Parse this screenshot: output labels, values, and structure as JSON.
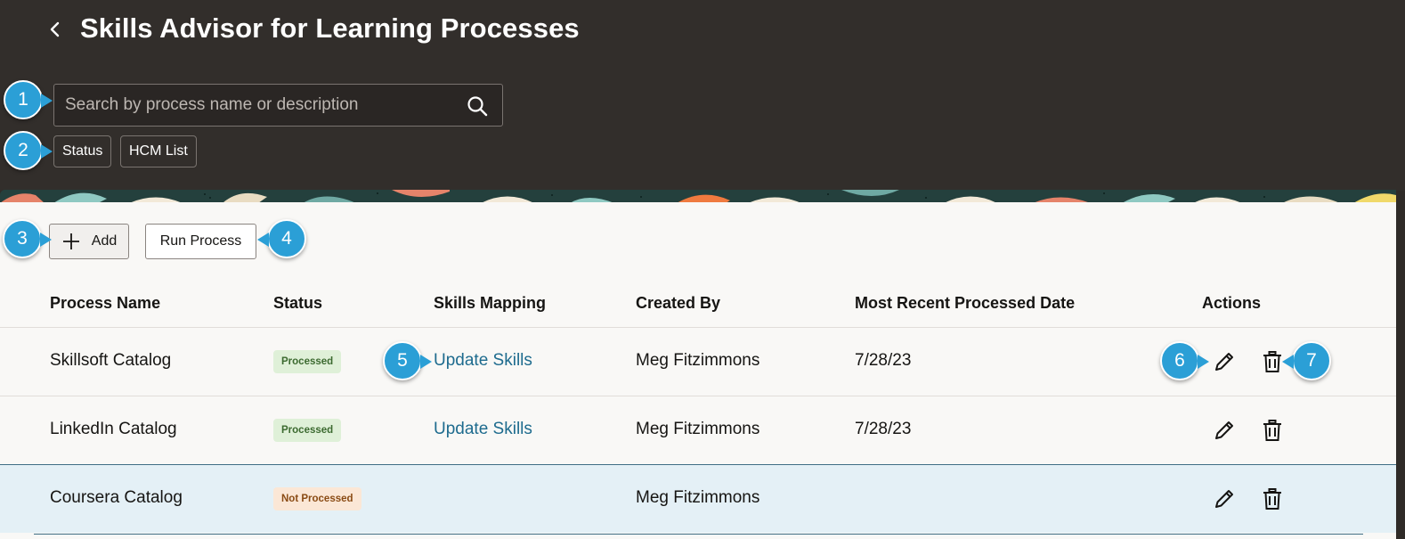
{
  "header": {
    "title": "Skills Advisor for Learning Processes",
    "search_placeholder": "Search by process name or description",
    "filters": [
      "Status",
      "HCM List"
    ]
  },
  "toolbar": {
    "add_label": "Add",
    "run_label": "Run Process"
  },
  "table": {
    "columns": [
      "Process Name",
      "Status",
      "Skills Mapping",
      "Created By",
      "Most Recent Processed Date",
      "Actions"
    ],
    "rows": [
      {
        "name": "Skillsoft Catalog",
        "status": "Processed",
        "mapping": "Update Skills",
        "created_by": "Meg Fitzimmons",
        "date": "7/28/23"
      },
      {
        "name": "LinkedIn Catalog",
        "status": "Processed",
        "mapping": "Update Skills",
        "created_by": "Meg Fitzimmons",
        "date": "7/28/23"
      },
      {
        "name": "Coursera Catalog",
        "status": "Not Processed",
        "mapping": "",
        "created_by": "Meg Fitzimmons",
        "date": ""
      }
    ]
  },
  "callouts": [
    "1",
    "2",
    "3",
    "4",
    "5",
    "6",
    "7"
  ],
  "icons": {
    "back": "chevron-left-icon",
    "search": "search-icon",
    "add": "plus-icon",
    "edit": "pencil-icon",
    "delete": "trash-icon"
  },
  "colors": {
    "header_bg": "#322e2b",
    "panel_bg": "#f9f8f6",
    "link": "#1e6b8e",
    "callout": "#2b9fd6",
    "selected_row": "#e4f0f6"
  }
}
